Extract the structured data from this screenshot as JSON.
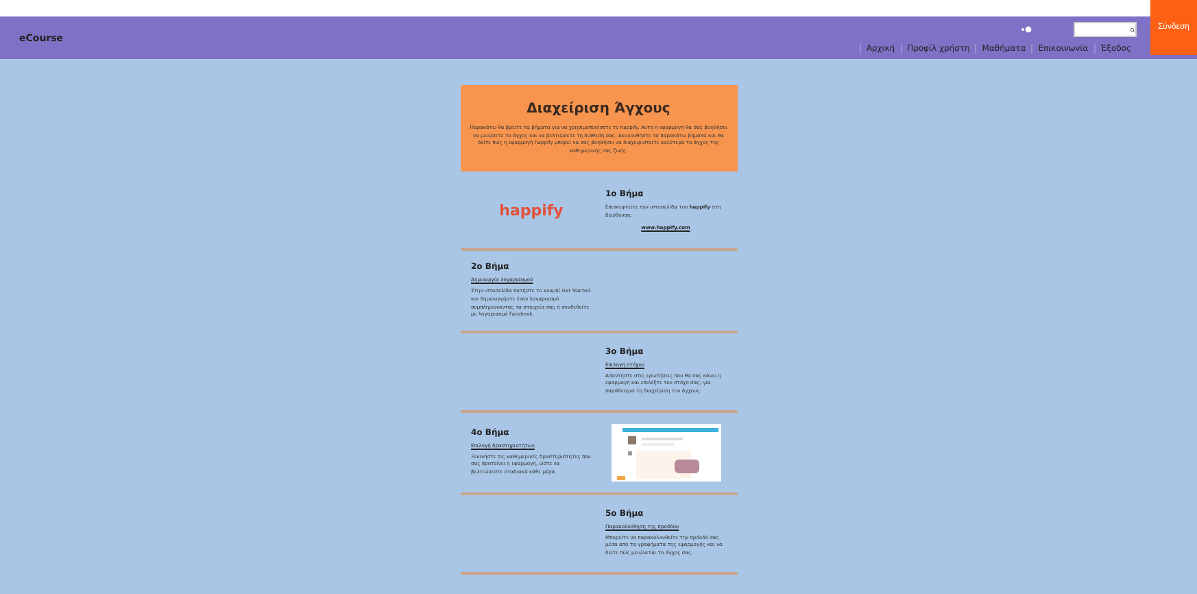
{
  "header": {
    "brand": "eCourse",
    "login_button": "Σύνδεση",
    "nav": [
      "Αρχική",
      "Προφίλ χρήστη",
      "Μαθήματα",
      "Επικοινωνία",
      "Έξοδος"
    ]
  },
  "intro": {
    "title": "Διαχείριση Άγχους",
    "text": "Παρακάτω θα βρείτε τα βήματα για να χρησιμοποιήσετε το happify. Αυτή η εφαρμογή θα σας βοηθήσει να μειώσετε το άγχος και να βελτιώσετε τη διάθεσή σας. Ακολουθήστε τα παρακάτω βήματα και θα δείτε πώς η εφαρμογή happify μπορεί να σας βοηθήσει να διαχειριστείτε καλύτερα το άγχος της καθημερινής σας ζωής."
  },
  "steps": [
    {
      "kind": "logo",
      "title": "1ο Βήμα",
      "text": "Επισκεφτείτε την ιστοσελίδα του **happify** στη διεύθυνση:",
      "url": "www.happify.com",
      "logo": "happify"
    },
    {
      "kind": "text-left",
      "title": "2ο Βήμα",
      "link": "Δημιουργία λογαριασμού",
      "text": "Στην ιστοσελίδα πατήστε το κουμπί Get Started και δημιουργήστε έναν λογαριασμό συμπληρώνοντας τα στοιχεία σας ή συνδεθείτε με λογαριασμό Facebook."
    },
    {
      "kind": "text-right",
      "title": "3ο Βήμα",
      "link": "Επιλογή στόχου",
      "text": "Απαντήστε στις ερωτήσεις που θα σας κάνει η εφαρμογή και επιλέξτε τον στόχο σας, για παράδειγμα τη διαχείριση του άγχους."
    },
    {
      "kind": "screenshot",
      "title": "4ο Βήμα",
      "link": "Επιλογή δραστηριοτήτων",
      "text": "Ξεκινήστε τις καθημερινές δραστηριότητες που σας προτείνει η εφαρμογή, ώστε να βελτιώνεστε σταδιακά κάθε μέρα."
    },
    {
      "kind": "text-right",
      "title": "5ο Βήμα",
      "link": "Παρακολούθηση της προόδου",
      "text": "Μπορείτε να παρακολουθείτε την πρόοδό σας μέσα από τα γραφήματα της εφαρμογής και να δείτε πώς μειώνεται το άγχος σας."
    }
  ]
}
